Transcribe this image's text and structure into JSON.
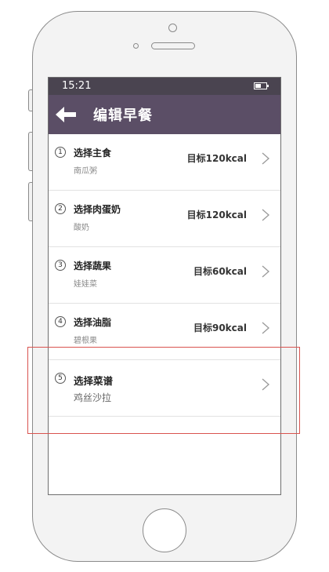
{
  "status": {
    "time": "15:21",
    "icons": [
      "battery-icon"
    ]
  },
  "navbar": {
    "back_icon": "arrow-left-icon",
    "title": "编辑早餐"
  },
  "items": [
    {
      "num": "1",
      "title": "选择主食",
      "sub": "南瓜粥",
      "target": "目标120kcal"
    },
    {
      "num": "2",
      "title": "选择肉蛋奶",
      "sub": "酸奶",
      "target": "目标120kcal"
    },
    {
      "num": "3",
      "title": "选择蔬果",
      "sub": "娃娃菜",
      "target": "目标60kcal"
    },
    {
      "num": "4",
      "title": "选择油脂",
      "sub": "碧根果",
      "target": "目标90kcal"
    },
    {
      "num": "5",
      "title": "选择菜谱",
      "sub": "鸡丝沙拉",
      "target": ""
    }
  ],
  "colors": {
    "navbar": "#5b4e66",
    "statusbar": "#4a4450",
    "highlight": "#d9534f"
  }
}
